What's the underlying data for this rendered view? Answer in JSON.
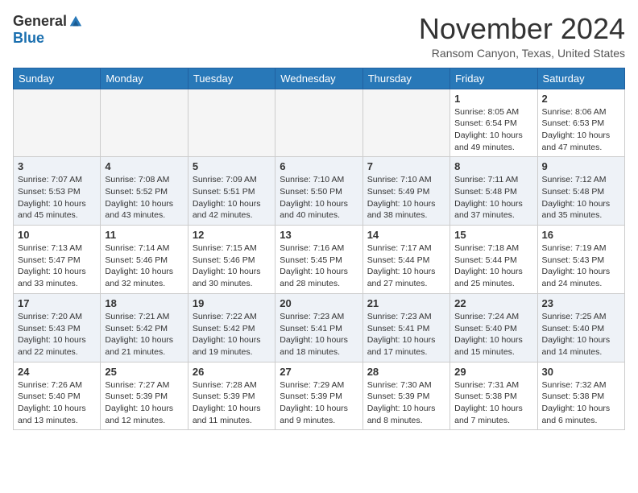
{
  "header": {
    "logo_general": "General",
    "logo_blue": "Blue",
    "month_title": "November 2024",
    "location": "Ransom Canyon, Texas, United States"
  },
  "days_of_week": [
    "Sunday",
    "Monday",
    "Tuesday",
    "Wednesday",
    "Thursday",
    "Friday",
    "Saturday"
  ],
  "weeks": [
    [
      {
        "day": "",
        "info": ""
      },
      {
        "day": "",
        "info": ""
      },
      {
        "day": "",
        "info": ""
      },
      {
        "day": "",
        "info": ""
      },
      {
        "day": "",
        "info": ""
      },
      {
        "day": "1",
        "info": "Sunrise: 8:05 AM\nSunset: 6:54 PM\nDaylight: 10 hours\nand 49 minutes."
      },
      {
        "day": "2",
        "info": "Sunrise: 8:06 AM\nSunset: 6:53 PM\nDaylight: 10 hours\nand 47 minutes."
      }
    ],
    [
      {
        "day": "3",
        "info": "Sunrise: 7:07 AM\nSunset: 5:53 PM\nDaylight: 10 hours\nand 45 minutes."
      },
      {
        "day": "4",
        "info": "Sunrise: 7:08 AM\nSunset: 5:52 PM\nDaylight: 10 hours\nand 43 minutes."
      },
      {
        "day": "5",
        "info": "Sunrise: 7:09 AM\nSunset: 5:51 PM\nDaylight: 10 hours\nand 42 minutes."
      },
      {
        "day": "6",
        "info": "Sunrise: 7:10 AM\nSunset: 5:50 PM\nDaylight: 10 hours\nand 40 minutes."
      },
      {
        "day": "7",
        "info": "Sunrise: 7:10 AM\nSunset: 5:49 PM\nDaylight: 10 hours\nand 38 minutes."
      },
      {
        "day": "8",
        "info": "Sunrise: 7:11 AM\nSunset: 5:48 PM\nDaylight: 10 hours\nand 37 minutes."
      },
      {
        "day": "9",
        "info": "Sunrise: 7:12 AM\nSunset: 5:48 PM\nDaylight: 10 hours\nand 35 minutes."
      }
    ],
    [
      {
        "day": "10",
        "info": "Sunrise: 7:13 AM\nSunset: 5:47 PM\nDaylight: 10 hours\nand 33 minutes."
      },
      {
        "day": "11",
        "info": "Sunrise: 7:14 AM\nSunset: 5:46 PM\nDaylight: 10 hours\nand 32 minutes."
      },
      {
        "day": "12",
        "info": "Sunrise: 7:15 AM\nSunset: 5:46 PM\nDaylight: 10 hours\nand 30 minutes."
      },
      {
        "day": "13",
        "info": "Sunrise: 7:16 AM\nSunset: 5:45 PM\nDaylight: 10 hours\nand 28 minutes."
      },
      {
        "day": "14",
        "info": "Sunrise: 7:17 AM\nSunset: 5:44 PM\nDaylight: 10 hours\nand 27 minutes."
      },
      {
        "day": "15",
        "info": "Sunrise: 7:18 AM\nSunset: 5:44 PM\nDaylight: 10 hours\nand 25 minutes."
      },
      {
        "day": "16",
        "info": "Sunrise: 7:19 AM\nSunset: 5:43 PM\nDaylight: 10 hours\nand 24 minutes."
      }
    ],
    [
      {
        "day": "17",
        "info": "Sunrise: 7:20 AM\nSunset: 5:43 PM\nDaylight: 10 hours\nand 22 minutes."
      },
      {
        "day": "18",
        "info": "Sunrise: 7:21 AM\nSunset: 5:42 PM\nDaylight: 10 hours\nand 21 minutes."
      },
      {
        "day": "19",
        "info": "Sunrise: 7:22 AM\nSunset: 5:42 PM\nDaylight: 10 hours\nand 19 minutes."
      },
      {
        "day": "20",
        "info": "Sunrise: 7:23 AM\nSunset: 5:41 PM\nDaylight: 10 hours\nand 18 minutes."
      },
      {
        "day": "21",
        "info": "Sunrise: 7:23 AM\nSunset: 5:41 PM\nDaylight: 10 hours\nand 17 minutes."
      },
      {
        "day": "22",
        "info": "Sunrise: 7:24 AM\nSunset: 5:40 PM\nDaylight: 10 hours\nand 15 minutes."
      },
      {
        "day": "23",
        "info": "Sunrise: 7:25 AM\nSunset: 5:40 PM\nDaylight: 10 hours\nand 14 minutes."
      }
    ],
    [
      {
        "day": "24",
        "info": "Sunrise: 7:26 AM\nSunset: 5:40 PM\nDaylight: 10 hours\nand 13 minutes."
      },
      {
        "day": "25",
        "info": "Sunrise: 7:27 AM\nSunset: 5:39 PM\nDaylight: 10 hours\nand 12 minutes."
      },
      {
        "day": "26",
        "info": "Sunrise: 7:28 AM\nSunset: 5:39 PM\nDaylight: 10 hours\nand 11 minutes."
      },
      {
        "day": "27",
        "info": "Sunrise: 7:29 AM\nSunset: 5:39 PM\nDaylight: 10 hours\nand 9 minutes."
      },
      {
        "day": "28",
        "info": "Sunrise: 7:30 AM\nSunset: 5:39 PM\nDaylight: 10 hours\nand 8 minutes."
      },
      {
        "day": "29",
        "info": "Sunrise: 7:31 AM\nSunset: 5:38 PM\nDaylight: 10 hours\nand 7 minutes."
      },
      {
        "day": "30",
        "info": "Sunrise: 7:32 AM\nSunset: 5:38 PM\nDaylight: 10 hours\nand 6 minutes."
      }
    ]
  ]
}
